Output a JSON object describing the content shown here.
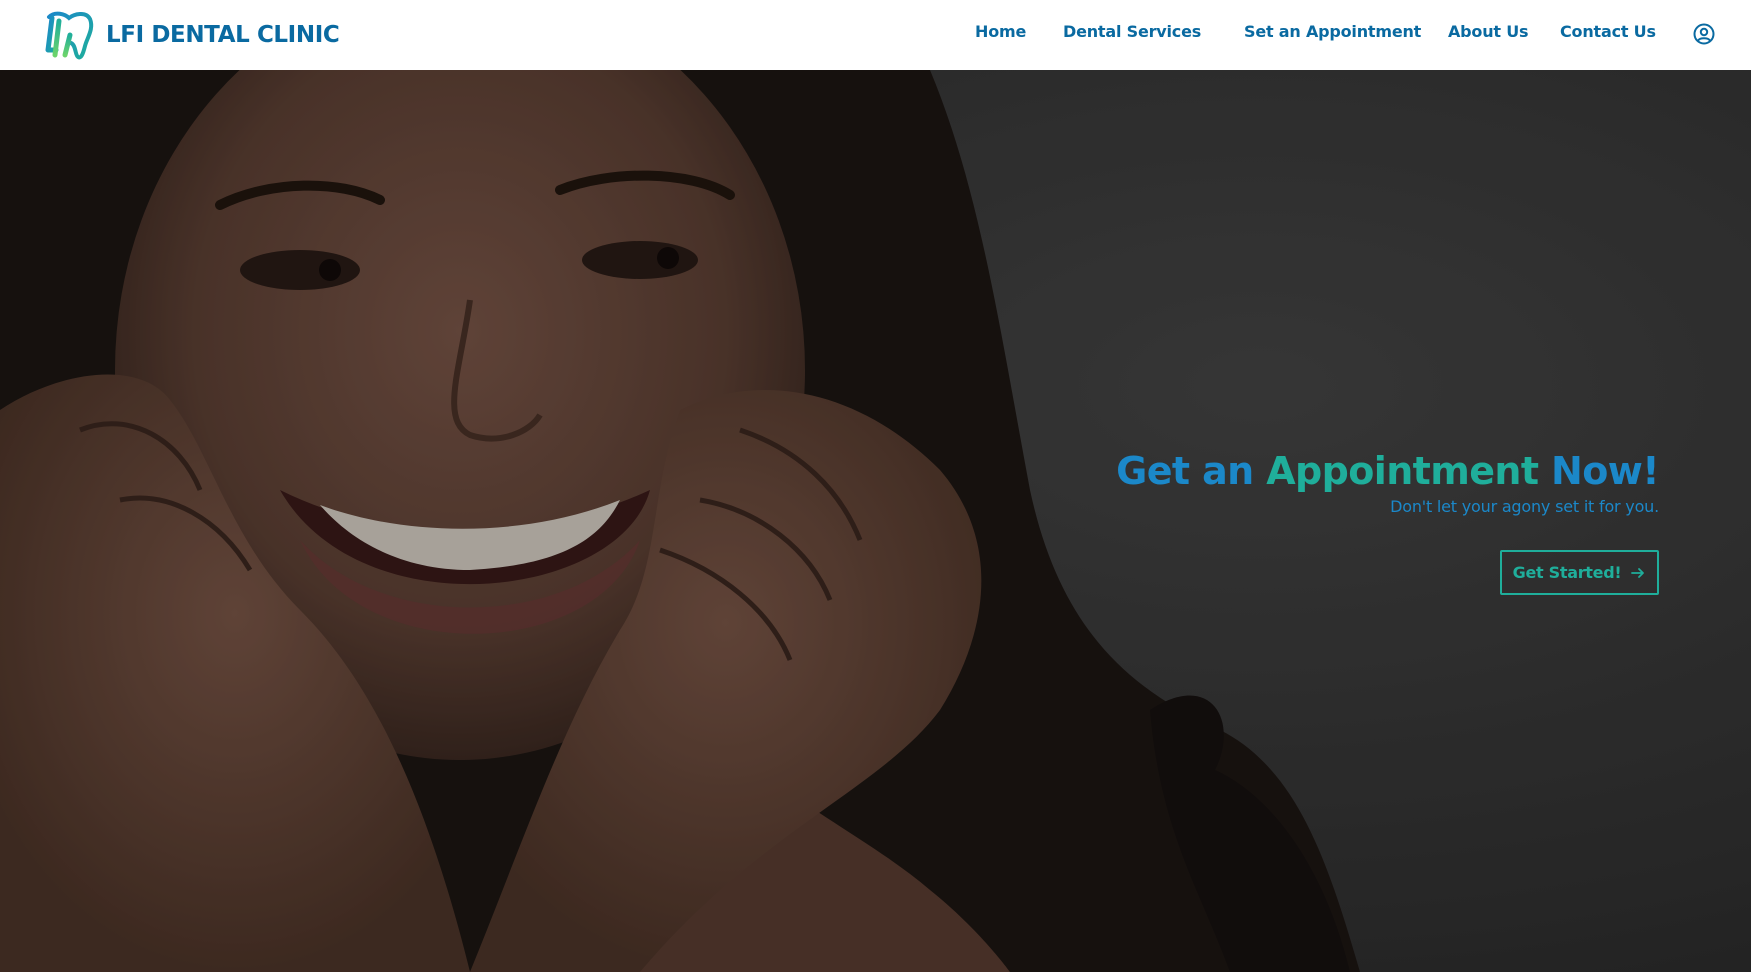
{
  "brand": {
    "name": "LFI DENTAL CLINIC",
    "logo_icon": "tooth-lf-logo-icon",
    "logo_colors": [
      "#1b88c9",
      "#1fae9b",
      "#6bd36b"
    ]
  },
  "nav": {
    "items": [
      {
        "label": "Home"
      },
      {
        "label": "Dental Services"
      },
      {
        "label": "Set an Appointment"
      },
      {
        "label": "About Us"
      },
      {
        "label": "Contact Us"
      }
    ],
    "account_icon": "user-circle-icon"
  },
  "hero": {
    "image": "smiling-woman-photo",
    "title": {
      "part1": "Get an",
      "part2": "Appointment",
      "part3": "Now!"
    },
    "subtitle": "Don't let your agony set it for you.",
    "button_label": "Get Started!",
    "button_icon": "arrow-right-icon"
  },
  "colors": {
    "primary_blue": "#0a6aa1",
    "accent_blue": "#1b88c9",
    "accent_teal": "#1fae9b"
  }
}
